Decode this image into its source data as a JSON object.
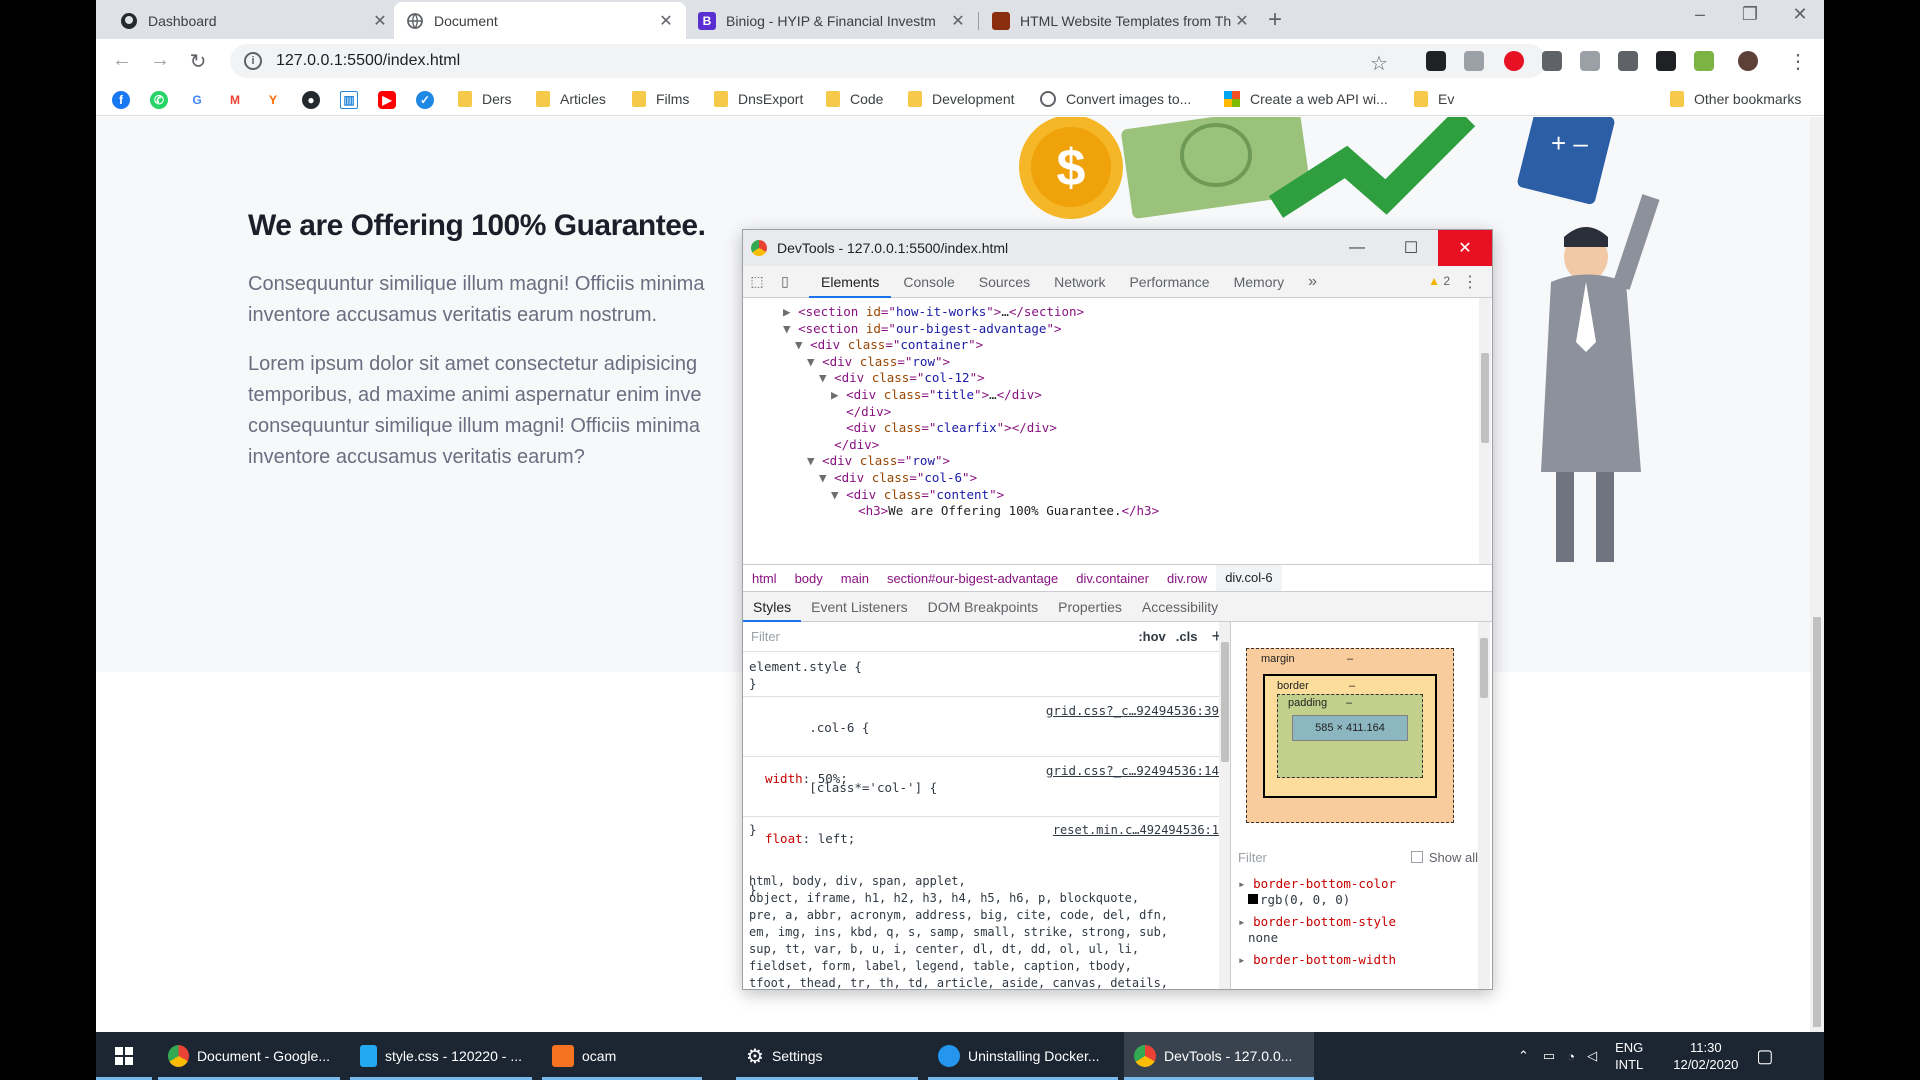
{
  "browser": {
    "tabs": [
      {
        "title": "Dashboard",
        "active": false,
        "icon": "github-icon"
      },
      {
        "title": "Document",
        "active": true,
        "icon": "globe-icon"
      },
      {
        "title": "Biniog - HYIP & Financial Investm",
        "active": false,
        "icon": "bootstrap-icon"
      },
      {
        "title": "HTML Website Templates from Th",
        "active": false,
        "icon": "template-icon"
      }
    ],
    "url": "127.0.0.1:5500/index.html",
    "bookmarks": [
      "Ders",
      "Articles",
      "Films",
      "DnsExport",
      "Code",
      "Development",
      "Convert images to...",
      "Create a web API wi...",
      "Ev"
    ],
    "other_bookmarks": "Other bookmarks"
  },
  "page": {
    "heading": "We are Offering 100% Guarantee.",
    "paragraph1": "Consequuntur similique illum magni! Officiis minima\ninventore accusamus veritatis earum nostrum.",
    "paragraph2": "Lorem ipsum dolor sit amet consectetur adipisicing\ntemporibus, ad maxime animi aspernatur enim inve\nconsequuntur similique illum magni! Officiis minima\ninventore accusamus veritatis earum?"
  },
  "devtools": {
    "window_title": "DevTools - 127.0.0.1:5500/index.html",
    "tabs": [
      "Elements",
      "Console",
      "Sources",
      "Network",
      "Performance",
      "Memory"
    ],
    "more_tabs": "»",
    "warnings": "2",
    "dom": [
      {
        "indent": 0,
        "tri": "▶",
        "open": "section",
        "attrs": [
          [
            "id",
            "how-it-works"
          ]
        ],
        "text": "…",
        "close": "section"
      },
      {
        "indent": 0,
        "tri": "▼",
        "open": "section",
        "attrs": [
          [
            "id",
            "our-bigest-advantage"
          ]
        ]
      },
      {
        "indent": 1,
        "tri": "▼",
        "open": "div",
        "attrs": [
          [
            "class",
            "container"
          ]
        ]
      },
      {
        "indent": 2,
        "tri": "▼",
        "open": "div",
        "attrs": [
          [
            "class",
            "row"
          ]
        ]
      },
      {
        "indent": 3,
        "tri": "▼",
        "open": "div",
        "attrs": [
          [
            "class",
            "col-12"
          ]
        ]
      },
      {
        "indent": 4,
        "tri": "▶",
        "open": "div",
        "attrs": [
          [
            "class",
            "title"
          ]
        ],
        "text": "…",
        "close": "div"
      },
      {
        "indent": 4,
        "tri": "",
        "closeonly": "div"
      },
      {
        "indent": 4,
        "tri": "",
        "open": "div",
        "attrs": [
          [
            "class",
            "clearfix"
          ]
        ],
        "text": "",
        "close": "div"
      },
      {
        "indent": 3,
        "tri": "",
        "closeonly": "div"
      },
      {
        "indent": 2,
        "tri": "▼",
        "open": "div",
        "attrs": [
          [
            "class",
            "row"
          ]
        ]
      },
      {
        "indent": 3,
        "tri": "▼",
        "open": "div",
        "attrs": [
          [
            "class",
            "col-6"
          ]
        ]
      },
      {
        "indent": 4,
        "tri": "▼",
        "open": "div",
        "attrs": [
          [
            "class",
            "content"
          ]
        ]
      },
      {
        "indent": 5,
        "tri": "",
        "open": "h3",
        "attrs": [],
        "text": "We are Offering 100% Guarantee.",
        "close": "h3"
      }
    ],
    "breadcrumbs": [
      "html",
      "body",
      "main",
      "section#our-bigest-advantage",
      "div.container",
      "div.row",
      "div.col-6"
    ],
    "subtabs": [
      "Styles",
      "Event Listeners",
      "DOM Breakpoints",
      "Properties",
      "Accessibility"
    ],
    "filter_placeholder": "Filter",
    "hov": ":hov",
    "cls": ".cls",
    "add": "+",
    "rules": {
      "element_style": "element.style {\n}",
      "col6_selector": ".col-6 {",
      "col6_link": "grid.css?_c…92494536:39",
      "col6_prop": "width",
      "col6_val": "50%;",
      "col_selector": "[class*='col-'] {",
      "col_link": "grid.css?_c…92494536:14",
      "col_prop": "float",
      "col_val": "left;",
      "reset_link": "reset.min.c…492494536:1",
      "reset_selectors": "html, body, div, span, applet,\nobject, iframe, h1, h2, h3, h4, h5, h6, p, blockquote,\npre, a, abbr, acronym, address, big, cite, code, del, dfn,\nem, img, ins, kbd, q, s, samp, small, strike, strong, sub,\nsup, tt, var, b, u, i, center, dl, dt, dd, ol, ul, li,\nfieldset, form, label, legend, table, caption, tbody,\ntfoot, thead, tr, th, td, article, aside, canvas, details,\nembed, figure, figcaption, footer, header, hgroup, menu,\nnav, output, ruby, section, summary, time, mark, audio,"
    },
    "boxmodel": {
      "margin": "margin",
      "border": "border",
      "padding": "padding",
      "dash": "–",
      "content": "585 × 411.164"
    },
    "computed": {
      "filter": "Filter",
      "show_all": "Show all",
      "props": [
        {
          "name": "border-bottom-color",
          "value": "rgb(0, 0, 0)"
        },
        {
          "name": "border-bottom-style",
          "value": "none"
        },
        {
          "name": "border-bottom-width",
          "value": ""
        }
      ]
    }
  },
  "taskbar": {
    "items": [
      {
        "label": "Document - Google...",
        "icon": "chrome-icon"
      },
      {
        "label": "style.css - 120220 - ...",
        "icon": "vscode-icon"
      },
      {
        "label": "ocam",
        "icon": "ocam-icon"
      },
      {
        "label": "Settings",
        "icon": "gear-icon"
      },
      {
        "label": "Uninstalling Docker...",
        "icon": "docker-icon"
      },
      {
        "label": "DevTools - 127.0.0...",
        "icon": "chrome-icon"
      }
    ],
    "lang": "ENG",
    "layout": "INTL",
    "time": "11:30",
    "date": "12/02/2020"
  },
  "colors": {
    "accent": "#1a73e8",
    "close_red": "#e81123",
    "taskbar": "#1c2633"
  }
}
